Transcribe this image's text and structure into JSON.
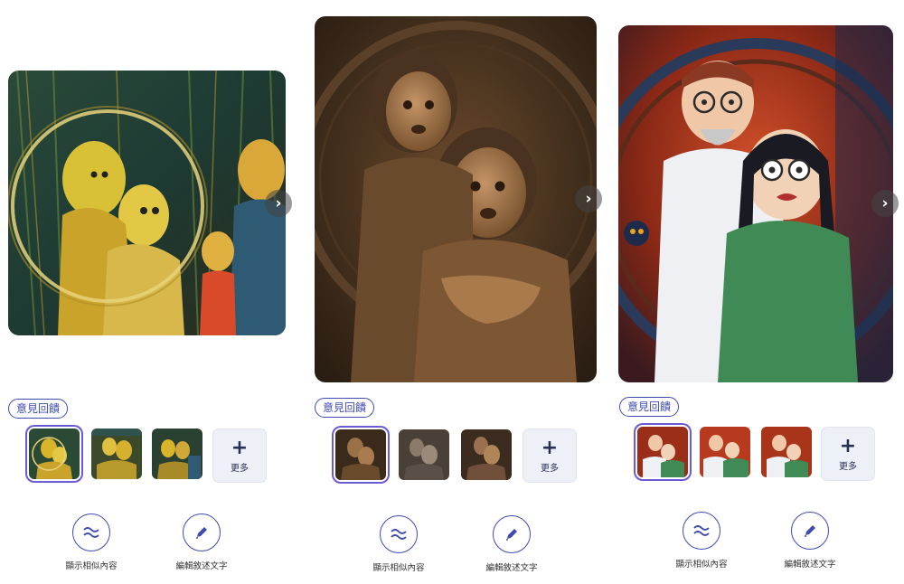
{
  "columns": [
    {
      "style": "yellow-painting",
      "feedback_label": "意見回饋",
      "more_label": "更多",
      "more_icon": "plus-icon",
      "next_icon": "chevron-right-icon",
      "actions": [
        {
          "label": "顯示相似內容",
          "icon": "approx-equal-icon"
        },
        {
          "label": "編輯敘述文字",
          "icon": "pencil-icon"
        }
      ],
      "palette": {
        "bg": "#233a2e",
        "main": "#d9b52a",
        "accent": "#3f6a8a"
      }
    },
    {
      "style": "bronze-relief",
      "feedback_label": "意見回饋",
      "more_label": "更多",
      "more_icon": "plus-icon",
      "next_icon": "chevron-right-icon",
      "actions": [
        {
          "label": "顯示相似內容",
          "icon": "approx-equal-icon"
        },
        {
          "label": "編輯敘述文字",
          "icon": "pencil-icon"
        }
      ],
      "palette": {
        "bg": "#3a2a1c",
        "main": "#8a6238",
        "accent": "#b98e5c"
      }
    },
    {
      "style": "anime-illustration",
      "feedback_label": "意見回饋",
      "more_label": "更多",
      "more_icon": "plus-icon",
      "next_icon": "chevron-right-icon",
      "actions": [
        {
          "label": "顯示相似內容",
          "icon": "approx-equal-icon"
        },
        {
          "label": "編輯敘述文字",
          "icon": "pencil-icon"
        }
      ],
      "palette": {
        "bg": "#9a2e18",
        "main": "#f0f0f0",
        "accent": "#3f8a55"
      }
    }
  ],
  "colors": {
    "accent": "#3f4bb0",
    "selected_ring": "#6a5ad8"
  }
}
